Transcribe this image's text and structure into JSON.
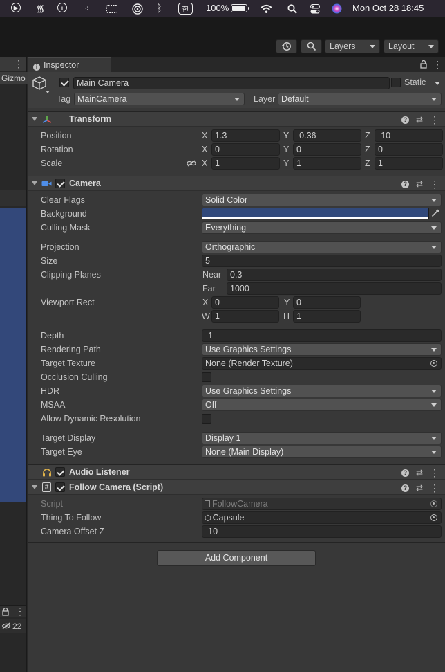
{
  "menubar": {
    "battery": "100%",
    "battery_level": 1.0,
    "clock": "Mon Oct 28  18:45",
    "input_method": "한",
    "icons": [
      "play-circle-icon",
      "swirl-icon",
      "info-circle-icon",
      "dots-icon",
      "sidebar-icon",
      "airdrop-icon",
      "bluetooth-icon",
      "input-method-icon",
      "battery-icon",
      "wifi-icon",
      "spotlight-icon",
      "control-center-icon",
      "siri-icon"
    ]
  },
  "toolbar": {
    "layers_label": "Layers",
    "layout_label": "Layout"
  },
  "left_panel": {
    "gizmo_label": "Gizmo",
    "visibility_count": "22"
  },
  "inspector": {
    "tab_label": "Inspector",
    "object": {
      "name": "Main Camera",
      "active": true,
      "static_label": "Static",
      "static": false,
      "tag_label": "Tag",
      "tag_value": "MainCamera",
      "layer_label": "Layer",
      "layer_value": "Default"
    },
    "transform": {
      "title": "Transform",
      "rows": [
        {
          "label": "Position",
          "x": "1.3",
          "y": "-0.36",
          "z": "-10"
        },
        {
          "label": "Rotation",
          "x": "0",
          "y": "0",
          "z": "0"
        },
        {
          "label": "Scale",
          "x": "1",
          "y": "1",
          "z": "1"
        }
      ],
      "axis_labels": [
        "X",
        "Y",
        "Z"
      ]
    },
    "camera": {
      "title": "Camera",
      "enabled": true,
      "clear_flags": {
        "label": "Clear Flags",
        "value": "Solid Color"
      },
      "background": {
        "label": "Background",
        "color": "#31497b"
      },
      "culling_mask": {
        "label": "Culling Mask",
        "value": "Everything"
      },
      "projection": {
        "label": "Projection",
        "value": "Orthographic"
      },
      "size": {
        "label": "Size",
        "value": "5"
      },
      "clipping": {
        "label": "Clipping Planes",
        "near_label": "Near",
        "near": "0.3",
        "far_label": "Far",
        "far": "1000"
      },
      "viewport": {
        "label": "Viewport Rect",
        "x": "0",
        "y": "0",
        "w": "1",
        "h": "1",
        "x_label": "X",
        "y_label": "Y",
        "w_label": "W",
        "h_label": "H"
      },
      "depth": {
        "label": "Depth",
        "value": "-1"
      },
      "rendering_path": {
        "label": "Rendering Path",
        "value": "Use Graphics Settings"
      },
      "target_texture": {
        "label": "Target Texture",
        "value": "None (Render Texture)"
      },
      "occlusion_culling": {
        "label": "Occlusion Culling",
        "checked": false
      },
      "hdr": {
        "label": "HDR",
        "value": "Use Graphics Settings"
      },
      "msaa": {
        "label": "MSAA",
        "value": "Off"
      },
      "dynamic_resolution": {
        "label": "Allow Dynamic Resolution",
        "checked": false
      },
      "target_display": {
        "label": "Target Display",
        "value": "Display 1"
      },
      "target_eye": {
        "label": "Target Eye",
        "value": "None (Main Display)"
      }
    },
    "audio_listener": {
      "title": "Audio Listener",
      "enabled": true
    },
    "follow_camera": {
      "title": "Follow Camera (Script)",
      "enabled": true,
      "script_label": "Script",
      "script_value": "FollowCamera",
      "thing_label": "Thing To Follow",
      "thing_value": "Capsule",
      "offset_label": "Camera Offset Z",
      "offset_value": "-10"
    },
    "add_component_label": "Add Component"
  }
}
